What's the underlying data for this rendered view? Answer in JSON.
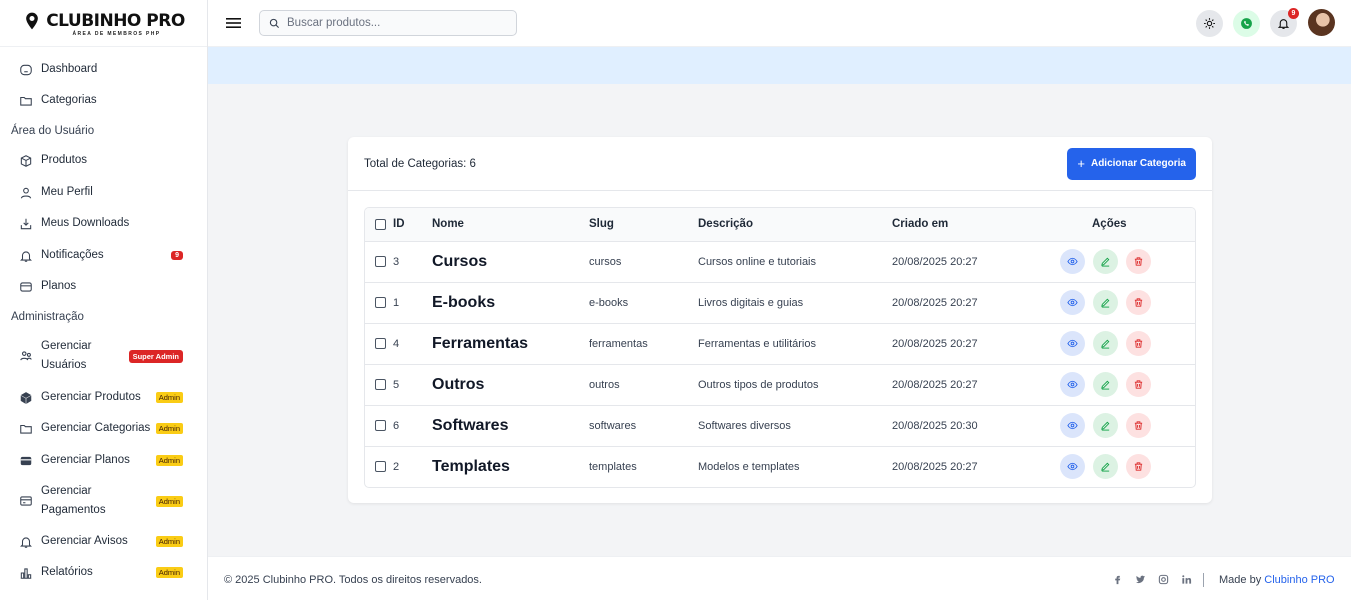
{
  "brand": {
    "title": "CLUBINHO PRO",
    "subtitle": "ÁREA DE MEMBROS PHP"
  },
  "sidebar": {
    "items_top": [
      {
        "label": "Dashboard",
        "icon": "dashboard-icon"
      },
      {
        "label": "Categorias",
        "icon": "folder-icon"
      }
    ],
    "section_user": "Área do Usuário",
    "items_user": [
      {
        "label": "Produtos",
        "icon": "box-icon"
      },
      {
        "label": "Meu Perfil",
        "icon": "user-icon"
      },
      {
        "label": "Meus Downloads",
        "icon": "download-icon"
      },
      {
        "label": "Notificações",
        "icon": "bell-icon",
        "badge": "9"
      },
      {
        "label": "Planos",
        "icon": "card-icon"
      }
    ],
    "section_admin": "Administração",
    "items_admin": [
      {
        "label": "Gerenciar Usuários",
        "icon": "users-icon",
        "badge": "Super Admin"
      },
      {
        "label": "Gerenciar Produtos",
        "icon": "cube-icon",
        "badge": "Admin"
      },
      {
        "label": "Gerenciar Categorias",
        "icon": "folder-icon",
        "badge": "Admin"
      },
      {
        "label": "Gerenciar Planos",
        "icon": "card-icon",
        "badge": "Admin"
      },
      {
        "label": "Gerenciar Pagamentos",
        "icon": "payment-icon",
        "badge": "Admin"
      },
      {
        "label": "Gerenciar Avisos",
        "icon": "bell-icon",
        "badge": "Admin"
      },
      {
        "label": "Relatórios",
        "icon": "chart-icon",
        "badge": "Admin"
      }
    ]
  },
  "topbar": {
    "search_placeholder": "Buscar produtos...",
    "notification_count": "9"
  },
  "card": {
    "total_label": "Total de Categorias: 6",
    "add_button": "Adicionar Categoria"
  },
  "table": {
    "headers": {
      "id": "ID",
      "name": "Nome",
      "slug": "Slug",
      "desc": "Descrição",
      "created": "Criado em",
      "actions": "Ações"
    },
    "rows": [
      {
        "id": "3",
        "name": "Cursos",
        "slug": "cursos",
        "desc": "Cursos online e tutoriais",
        "created": "20/08/2025 20:27"
      },
      {
        "id": "1",
        "name": "E-books",
        "slug": "e-books",
        "desc": "Livros digitais e guias",
        "created": "20/08/2025 20:27"
      },
      {
        "id": "4",
        "name": "Ferramentas",
        "slug": "ferramentas",
        "desc": "Ferramentas e utilitários",
        "created": "20/08/2025 20:27"
      },
      {
        "id": "5",
        "name": "Outros",
        "slug": "outros",
        "desc": "Outros tipos de produtos",
        "created": "20/08/2025 20:27"
      },
      {
        "id": "6",
        "name": "Softwares",
        "slug": "softwares",
        "desc": "Softwares diversos",
        "created": "20/08/2025 20:30"
      },
      {
        "id": "2",
        "name": "Templates",
        "slug": "templates",
        "desc": "Modelos e templates",
        "created": "20/08/2025 20:27"
      }
    ]
  },
  "footer": {
    "copyright": "© 2025 Clubinho PRO. Todos os direitos reservados.",
    "made_by_prefix": "Made by",
    "made_by_link": "Clubinho PRO"
  },
  "colors": {
    "primary": "#2563eb",
    "danger": "#dc2626",
    "admin_badge": "#facc15",
    "banner": "#e0efff"
  }
}
